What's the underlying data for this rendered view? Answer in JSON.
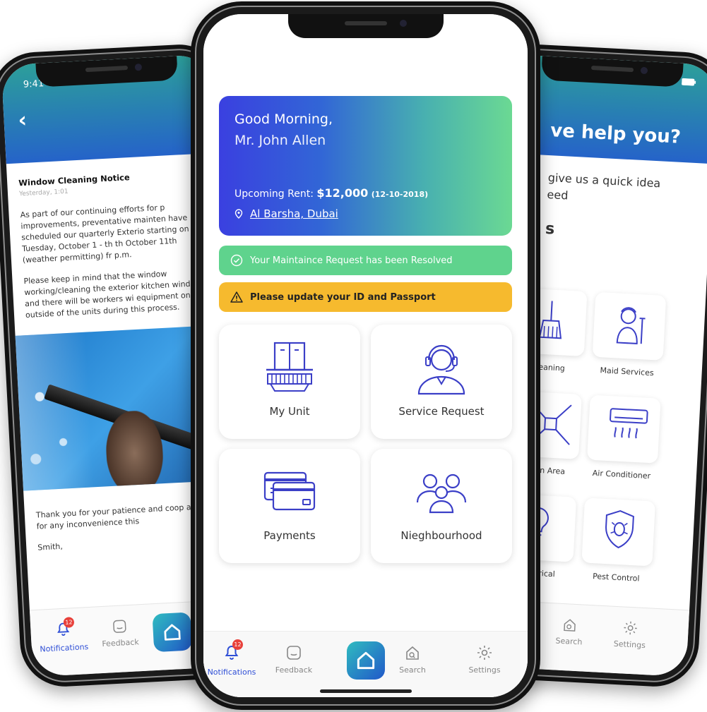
{
  "left_phone": {
    "status_time": "9:41",
    "notice": {
      "title": "Window Cleaning Notice",
      "date": "Yesterday, 1:01",
      "para1": "As part of our continuing efforts for p improvements, preventative mainten have scheduled our quarterly Exterio starting on Tuesday, October 1 - th th October 11th (weather permitting) fr p.m.",
      "para2": "Please keep in mind that the window working/cleaning the exterior kitchen windows and there will be workers wi equipment on the outside of the units during this process.",
      "para3": "Thank you for your patience and coop apologize for any inconvenience this",
      "sign": "Smith,"
    },
    "tabbar": {
      "notifications": "Notifications",
      "feedback": "Feedback",
      "badge": "12"
    }
  },
  "right_phone": {
    "title": "ve help you?",
    "subtitle_line1": "give us a quick idea",
    "subtitle_line2": "eed",
    "section_letter": "s",
    "services": [
      "Cleaning",
      "Maid Services",
      "mmon Area",
      "Air Conditioner",
      "Electrical",
      "Pest Control"
    ],
    "tabbar": {
      "search": "Search",
      "settings": "Settings"
    }
  },
  "center_phone": {
    "greeting_line1": "Good Morning,",
    "greeting_line2": "Mr. John Allen",
    "rent_label": "Upcoming Rent: ",
    "rent_amount": "$12,000",
    "rent_date": "(12-10-2018)",
    "location": "Al Barsha, Dubai",
    "banner_success": "Your Maintaince Request has been Resolved",
    "banner_warning": "Please update your ID and Passport",
    "tiles": [
      "My Unit",
      "Service Request",
      "Payments",
      "Nieghbourhood"
    ],
    "tabbar": {
      "notifications": "Notifications",
      "feedback": "Feedback",
      "search": "Search",
      "settings": "Settings",
      "badge": "12"
    }
  },
  "colors": {
    "accent_blue": "#2f4fd6",
    "success_green": "#5fd38d",
    "warning_yellow": "#f6ba2e",
    "icon_stroke": "#3b3fc7"
  }
}
